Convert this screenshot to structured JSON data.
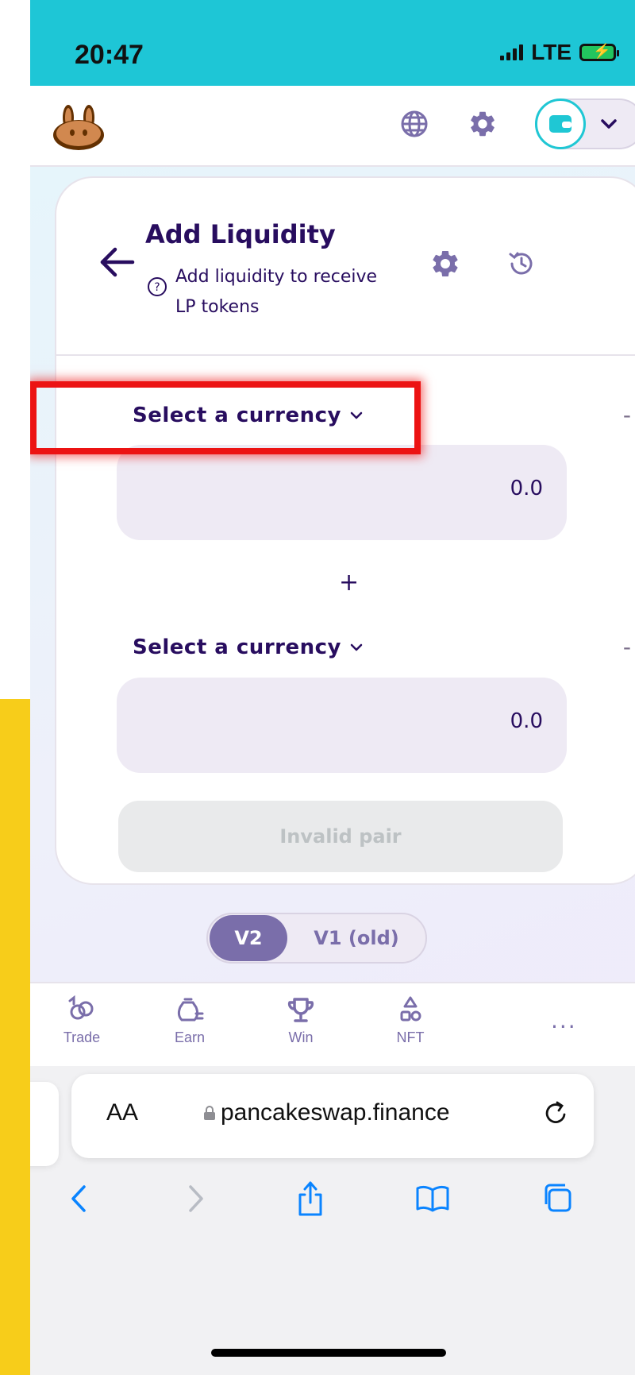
{
  "status_bar": {
    "time": "20:47",
    "network": "LTE"
  },
  "card": {
    "title": "Add Liquidity",
    "subtitle_line1": "Add liquidity to receive",
    "subtitle_line2": "LP tokens",
    "currency_a": {
      "label": "Select a currency",
      "balance": "-",
      "amount_placeholder": "0.0"
    },
    "plus_symbol": "+",
    "currency_b": {
      "label": "Select a currency",
      "balance": "-",
      "amount_placeholder": "0.0"
    },
    "submit_label": "Invalid pair"
  },
  "version_toggle": {
    "active": "V2",
    "inactive": "V1 (old)"
  },
  "bottom_nav": {
    "items": [
      {
        "label": "Trade"
      },
      {
        "label": "Earn"
      },
      {
        "label": "Win"
      },
      {
        "label": "NFT"
      }
    ],
    "more": "..."
  },
  "browser": {
    "text_size_label": "AA",
    "url": "pancakeswap.finance"
  },
  "colors": {
    "accent_cyan": "#1fc7d4",
    "primary_text": "#280d5f",
    "secondary": "#7a6eaa",
    "input_bg": "#eeeaf4",
    "highlight_red": "#ec1313"
  }
}
